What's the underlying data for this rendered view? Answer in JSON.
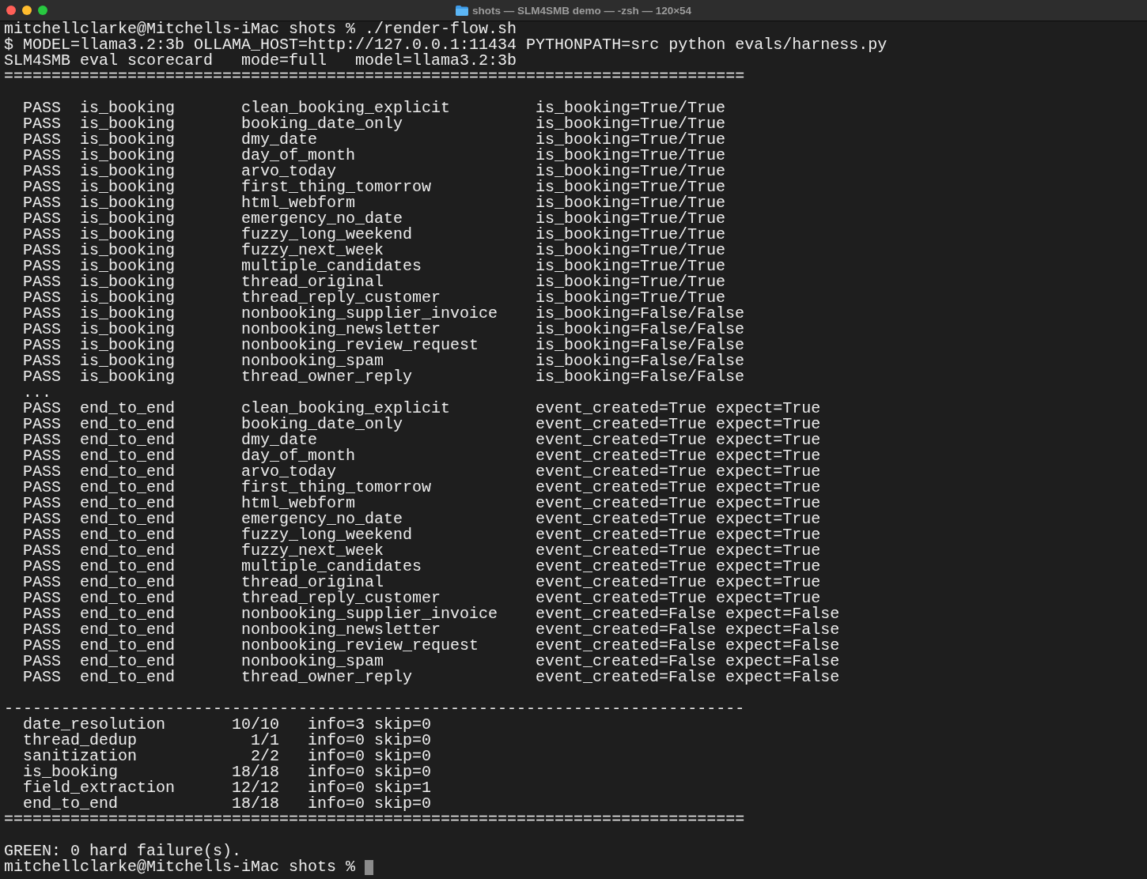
{
  "window": {
    "title": "shots — SLM4SMB demo — -zsh — 120×54"
  },
  "terminal": {
    "launch": {
      "prompt": "mitchellclarke@Mitchells-iMac shots %",
      "command": "./render-flow.sh"
    },
    "echo": "$ MODEL=llama3.2:3b OLLAMA_HOST=http://127.0.0.1:11434 PYTHONPATH=src python evals/harness.py",
    "header": {
      "title": "SLM4SMB eval scorecard",
      "mode": "mode=full",
      "model": "model=llama3.2:3b"
    },
    "rule_top": "==============================================================================",
    "results": [
      {
        "kind": "row",
        "status": "PASS",
        "suite": "is_booking",
        "case": "clean_booking_explicit",
        "detail": "is_booking=True/True"
      },
      {
        "kind": "row",
        "status": "PASS",
        "suite": "is_booking",
        "case": "booking_date_only",
        "detail": "is_booking=True/True"
      },
      {
        "kind": "row",
        "status": "PASS",
        "suite": "is_booking",
        "case": "dmy_date",
        "detail": "is_booking=True/True"
      },
      {
        "kind": "row",
        "status": "PASS",
        "suite": "is_booking",
        "case": "day_of_month",
        "detail": "is_booking=True/True"
      },
      {
        "kind": "row",
        "status": "PASS",
        "suite": "is_booking",
        "case": "arvo_today",
        "detail": "is_booking=True/True"
      },
      {
        "kind": "row",
        "status": "PASS",
        "suite": "is_booking",
        "case": "first_thing_tomorrow",
        "detail": "is_booking=True/True"
      },
      {
        "kind": "row",
        "status": "PASS",
        "suite": "is_booking",
        "case": "html_webform",
        "detail": "is_booking=True/True"
      },
      {
        "kind": "row",
        "status": "PASS",
        "suite": "is_booking",
        "case": "emergency_no_date",
        "detail": "is_booking=True/True"
      },
      {
        "kind": "row",
        "status": "PASS",
        "suite": "is_booking",
        "case": "fuzzy_long_weekend",
        "detail": "is_booking=True/True"
      },
      {
        "kind": "row",
        "status": "PASS",
        "suite": "is_booking",
        "case": "fuzzy_next_week",
        "detail": "is_booking=True/True"
      },
      {
        "kind": "row",
        "status": "PASS",
        "suite": "is_booking",
        "case": "multiple_candidates",
        "detail": "is_booking=True/True"
      },
      {
        "kind": "row",
        "status": "PASS",
        "suite": "is_booking",
        "case": "thread_original",
        "detail": "is_booking=True/True"
      },
      {
        "kind": "row",
        "status": "PASS",
        "suite": "is_booking",
        "case": "thread_reply_customer",
        "detail": "is_booking=True/True"
      },
      {
        "kind": "row",
        "status": "PASS",
        "suite": "is_booking",
        "case": "nonbooking_supplier_invoice",
        "detail": "is_booking=False/False"
      },
      {
        "kind": "row",
        "status": "PASS",
        "suite": "is_booking",
        "case": "nonbooking_newsletter",
        "detail": "is_booking=False/False"
      },
      {
        "kind": "row",
        "status": "PASS",
        "suite": "is_booking",
        "case": "nonbooking_review_request",
        "detail": "is_booking=False/False"
      },
      {
        "kind": "row",
        "status": "PASS",
        "suite": "is_booking",
        "case": "nonbooking_spam",
        "detail": "is_booking=False/False"
      },
      {
        "kind": "row",
        "status": "PASS",
        "suite": "is_booking",
        "case": "thread_owner_reply",
        "detail": "is_booking=False/False"
      },
      {
        "kind": "ellipsis",
        "text": "..."
      },
      {
        "kind": "row",
        "status": "PASS",
        "suite": "end_to_end",
        "case": "clean_booking_explicit",
        "detail": "event_created=True expect=True"
      },
      {
        "kind": "row",
        "status": "PASS",
        "suite": "end_to_end",
        "case": "booking_date_only",
        "detail": "event_created=True expect=True"
      },
      {
        "kind": "row",
        "status": "PASS",
        "suite": "end_to_end",
        "case": "dmy_date",
        "detail": "event_created=True expect=True"
      },
      {
        "kind": "row",
        "status": "PASS",
        "suite": "end_to_end",
        "case": "day_of_month",
        "detail": "event_created=True expect=True"
      },
      {
        "kind": "row",
        "status": "PASS",
        "suite": "end_to_end",
        "case": "arvo_today",
        "detail": "event_created=True expect=True"
      },
      {
        "kind": "row",
        "status": "PASS",
        "suite": "end_to_end",
        "case": "first_thing_tomorrow",
        "detail": "event_created=True expect=True"
      },
      {
        "kind": "row",
        "status": "PASS",
        "suite": "end_to_end",
        "case": "html_webform",
        "detail": "event_created=True expect=True"
      },
      {
        "kind": "row",
        "status": "PASS",
        "suite": "end_to_end",
        "case": "emergency_no_date",
        "detail": "event_created=True expect=True"
      },
      {
        "kind": "row",
        "status": "PASS",
        "suite": "end_to_end",
        "case": "fuzzy_long_weekend",
        "detail": "event_created=True expect=True"
      },
      {
        "kind": "row",
        "status": "PASS",
        "suite": "end_to_end",
        "case": "fuzzy_next_week",
        "detail": "event_created=True expect=True"
      },
      {
        "kind": "row",
        "status": "PASS",
        "suite": "end_to_end",
        "case": "multiple_candidates",
        "detail": "event_created=True expect=True"
      },
      {
        "kind": "row",
        "status": "PASS",
        "suite": "end_to_end",
        "case": "thread_original",
        "detail": "event_created=True expect=True"
      },
      {
        "kind": "row",
        "status": "PASS",
        "suite": "end_to_end",
        "case": "thread_reply_customer",
        "detail": "event_created=True expect=True"
      },
      {
        "kind": "row",
        "status": "PASS",
        "suite": "end_to_end",
        "case": "nonbooking_supplier_invoice",
        "detail": "event_created=False expect=False"
      },
      {
        "kind": "row",
        "status": "PASS",
        "suite": "end_to_end",
        "case": "nonbooking_newsletter",
        "detail": "event_created=False expect=False"
      },
      {
        "kind": "row",
        "status": "PASS",
        "suite": "end_to_end",
        "case": "nonbooking_review_request",
        "detail": "event_created=False expect=False"
      },
      {
        "kind": "row",
        "status": "PASS",
        "suite": "end_to_end",
        "case": "nonbooking_spam",
        "detail": "event_created=False expect=False"
      },
      {
        "kind": "row",
        "status": "PASS",
        "suite": "end_to_end",
        "case": "thread_owner_reply",
        "detail": "event_created=False expect=False"
      }
    ],
    "rule_mid": "------------------------------------------------------------------------------",
    "summary": [
      {
        "name": "date_resolution",
        "count": "10/10",
        "detail": "info=3 skip=0"
      },
      {
        "name": "thread_dedup",
        "count": "1/1",
        "detail": "info=0 skip=0"
      },
      {
        "name": "sanitization",
        "count": "2/2",
        "detail": "info=0 skip=0"
      },
      {
        "name": "is_booking",
        "count": "18/18",
        "detail": "info=0 skip=0"
      },
      {
        "name": "field_extraction",
        "count": "12/12",
        "detail": "info=0 skip=1"
      },
      {
        "name": "end_to_end",
        "count": "18/18",
        "detail": "info=0 skip=0"
      }
    ],
    "rule_bottom": "==============================================================================",
    "verdict": "GREEN: 0 hard failure(s).",
    "final_prompt": {
      "prompt": "mitchellclarke@Mitchells-iMac shots %",
      "cursor": true
    }
  }
}
